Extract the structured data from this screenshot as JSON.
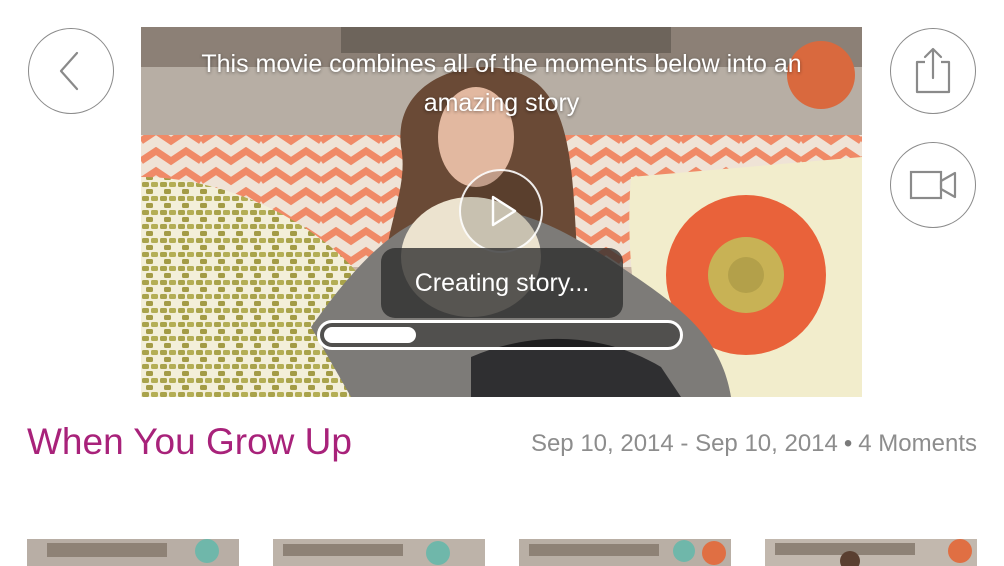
{
  "video": {
    "caption": "This movie combines all of the moments below into an amazing story",
    "status_text": "Creating story...",
    "progress": 0.26
  },
  "story": {
    "title": "When You Grow Up",
    "date_range": "Sep 10, 2014 - Sep 10, 2014",
    "separator": "•",
    "moments": "4 Moments"
  },
  "icons": {
    "back": "chevron-left-icon",
    "share": "share-icon",
    "record": "video-camera-icon",
    "play": "play-icon"
  },
  "colors": {
    "title": "#a8227a",
    "meta": "#8d8d8d",
    "icon_stroke": "#8a8a8a"
  },
  "thumbnails": [
    "moment-1",
    "moment-2",
    "moment-3",
    "moment-4"
  ]
}
